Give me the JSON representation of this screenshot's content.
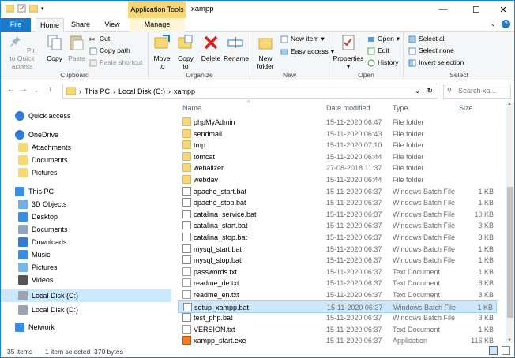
{
  "window": {
    "title": "xampp",
    "context_tab_group": "Application Tools",
    "controls": {
      "minimize": "—",
      "maximize": "☐",
      "close": "✕"
    }
  },
  "ribbon_tabs": [
    "File",
    "Home",
    "Share",
    "View",
    "Manage"
  ],
  "ribbon": {
    "clipboard": {
      "label": "Clipboard",
      "pin": "Pin to Quick access",
      "copy": "Copy",
      "paste": "Paste",
      "cut": "Cut",
      "copy_path": "Copy path",
      "paste_shortcut": "Paste shortcut"
    },
    "organize": {
      "label": "Organize",
      "move_to": "Move to",
      "copy_to": "Copy to",
      "delete": "Delete",
      "rename": "Rename"
    },
    "new": {
      "label": "New",
      "new_folder": "New folder",
      "new_item": "New item",
      "easy_access": "Easy access"
    },
    "open": {
      "label": "Open",
      "properties": "Properties",
      "open": "Open",
      "edit": "Edit",
      "history": "History"
    },
    "select": {
      "label": "Select",
      "select_all": "Select all",
      "select_none": "Select none",
      "invert": "Invert selection"
    }
  },
  "address": {
    "crumbs": [
      "This PC",
      "Local Disk (C:)",
      "xampp"
    ],
    "search_placeholder": "Search xa..."
  },
  "nav_pane": [
    {
      "label": "Quick access",
      "icon": "star-icon",
      "indent": 0
    },
    {
      "label": "OneDrive",
      "icon": "cloud-icon",
      "indent": 0
    },
    {
      "label": "Attachments",
      "icon": "folder-icon",
      "indent": 1
    },
    {
      "label": "Documents",
      "icon": "folder-icon",
      "indent": 1
    },
    {
      "label": "Pictures",
      "icon": "folder-icon",
      "indent": 1
    },
    {
      "label": "This PC",
      "icon": "computer-icon",
      "indent": 0
    },
    {
      "label": "3D Objects",
      "icon": "cube-icon",
      "indent": 1
    },
    {
      "label": "Desktop",
      "icon": "desktop-icon",
      "indent": 1
    },
    {
      "label": "Documents",
      "icon": "documents-icon",
      "indent": 1
    },
    {
      "label": "Downloads",
      "icon": "download-icon",
      "indent": 1
    },
    {
      "label": "Music",
      "icon": "music-icon",
      "indent": 1
    },
    {
      "label": "Pictures",
      "icon": "pictures-icon",
      "indent": 1
    },
    {
      "label": "Videos",
      "icon": "videos-icon",
      "indent": 1
    },
    {
      "label": "Local Disk (C:)",
      "icon": "drive-icon",
      "indent": 1,
      "selected": true
    },
    {
      "label": "Local Disk (D:)",
      "icon": "drive-icon",
      "indent": 1
    },
    {
      "label": "Network",
      "icon": "network-icon",
      "indent": 0
    }
  ],
  "columns": {
    "name": "Name",
    "date": "Date modified",
    "type": "Type",
    "size": "Size"
  },
  "files": [
    {
      "name": "phpMyAdmin",
      "date": "15-11-2020 06:47",
      "type": "File folder",
      "size": "",
      "kind": "folder"
    },
    {
      "name": "sendmail",
      "date": "15-11-2020 06:43",
      "type": "File folder",
      "size": "",
      "kind": "folder"
    },
    {
      "name": "tmp",
      "date": "15-11-2020 07:10",
      "type": "File folder",
      "size": "",
      "kind": "folder"
    },
    {
      "name": "tomcat",
      "date": "15-11-2020 06:44",
      "type": "File folder",
      "size": "",
      "kind": "folder"
    },
    {
      "name": "webalizer",
      "date": "27-08-2018 11:37",
      "type": "File folder",
      "size": "",
      "kind": "folder"
    },
    {
      "name": "webdav",
      "date": "15-11-2020 06:44",
      "type": "File folder",
      "size": "",
      "kind": "folder"
    },
    {
      "name": "apache_start.bat",
      "date": "15-11-2020 06:37",
      "type": "Windows Batch File",
      "size": "1 KB",
      "kind": "bat"
    },
    {
      "name": "apache_stop.bat",
      "date": "15-11-2020 06:37",
      "type": "Windows Batch File",
      "size": "1 KB",
      "kind": "bat"
    },
    {
      "name": "catalina_service.bat",
      "date": "15-11-2020 06:37",
      "type": "Windows Batch File",
      "size": "10 KB",
      "kind": "bat"
    },
    {
      "name": "catalina_start.bat",
      "date": "15-11-2020 06:37",
      "type": "Windows Batch File",
      "size": "3 KB",
      "kind": "bat"
    },
    {
      "name": "catalina_stop.bat",
      "date": "15-11-2020 06:37",
      "type": "Windows Batch File",
      "size": "3 KB",
      "kind": "bat"
    },
    {
      "name": "mysql_start.bat",
      "date": "15-11-2020 06:37",
      "type": "Windows Batch File",
      "size": "1 KB",
      "kind": "bat"
    },
    {
      "name": "mysql_stop.bat",
      "date": "15-11-2020 06:37",
      "type": "Windows Batch File",
      "size": "1 KB",
      "kind": "bat"
    },
    {
      "name": "passwords.txt",
      "date": "15-11-2020 06:37",
      "type": "Text Document",
      "size": "1 KB",
      "kind": "txt"
    },
    {
      "name": "readme_de.txt",
      "date": "15-11-2020 06:37",
      "type": "Text Document",
      "size": "8 KB",
      "kind": "txt"
    },
    {
      "name": "readme_en.txt",
      "date": "15-11-2020 06:37",
      "type": "Text Document",
      "size": "8 KB",
      "kind": "txt"
    },
    {
      "name": "setup_xampp.bat",
      "date": "15-11-2020 06:37",
      "type": "Windows Batch File",
      "size": "1 KB",
      "kind": "bat",
      "selected": true
    },
    {
      "name": "test_php.bat",
      "date": "15-11-2020 06:37",
      "type": "Windows Batch File",
      "size": "3 KB",
      "kind": "bat"
    },
    {
      "name": "VERSION.txt",
      "date": "15-11-2020 06:37",
      "type": "Text Document",
      "size": "1 KB",
      "kind": "txt"
    },
    {
      "name": "xampp_start.exe",
      "date": "15-11-2020 06:37",
      "type": "Application",
      "size": "116 KB",
      "kind": "exe"
    }
  ],
  "status": {
    "items": "35 items",
    "selected": "1 item selected",
    "size": "370 bytes"
  },
  "colors": {
    "accent": "#1979ca",
    "selection": "#cce8ff",
    "folder": "#f8d775",
    "context_tab": "#f5d778"
  }
}
